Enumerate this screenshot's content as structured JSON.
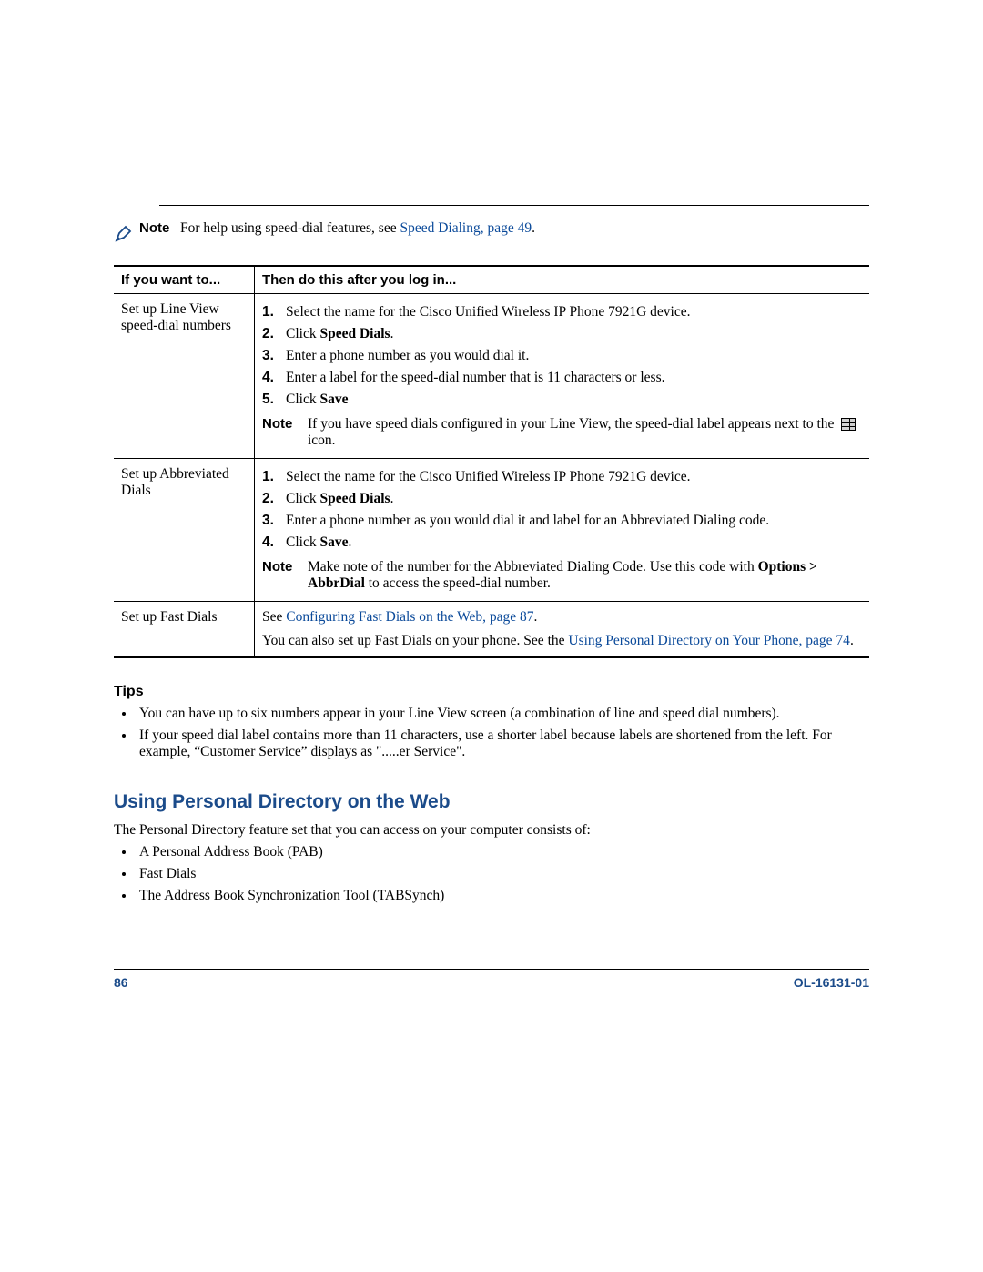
{
  "note": {
    "label": "Note",
    "text_prefix": "For help using speed-dial features, see ",
    "link": "Speed Dialing, page 49",
    "text_suffix": "."
  },
  "table": {
    "headers": {
      "col1": "If you want to...",
      "col2": "Then do this after you log in..."
    },
    "rows": [
      {
        "left": "Set up Line View speed-dial numbers",
        "steps": [
          "Select the name for the Cisco Unified Wireless IP Phone 7921G device.",
          "Click |Speed Dials|.",
          "Enter a phone number as you would dial it.",
          "Enter a label for the speed-dial number that is 11 characters or less.",
          "Click |Save|"
        ],
        "note": {
          "label": "Note",
          "text_pre": "If you have speed dials configured in your Line View, the speed-dial label appears next to the ",
          "text_post": " icon."
        }
      },
      {
        "left": "Set up Abbreviated Dials",
        "steps": [
          "Select the name for the Cisco Unified Wireless IP Phone 7921G device.",
          "Click |Speed Dials|.",
          "Enter a phone number as you would dial it and label for an Abbreviated Dialing code.",
          "Click |Save|."
        ],
        "note": {
          "label": "Note",
          "text": "Make note of the number for the Abbreviated Dialing Code. Use this code with |Options > AbbrDial| to access the speed-dial number."
        }
      },
      {
        "left": "Set up Fast Dials",
        "line1_pre": "See ",
        "line1_link": "Configuring Fast Dials on the Web, page 87",
        "line1_post": ".",
        "line2_pre": "You can also set up Fast Dials on your phone. See the ",
        "line2_link": "Using Personal Directory on Your Phone, page 74",
        "line2_post": "."
      }
    ]
  },
  "tips": {
    "heading": "Tips",
    "items": [
      "You can have up to six numbers appear in your Line View screen (a combination of line and speed dial numbers).",
      "If your speed dial label contains more than 11 characters, use a shorter label because labels are shortened from the left. For example, “Customer Service” displays as \".....er Service\"."
    ]
  },
  "section": {
    "heading": "Using Personal Directory on the Web",
    "intro": "The Personal Directory feature set that you can access on your computer consists of:",
    "items": [
      "A Personal Address Book (PAB)",
      "Fast Dials",
      "The Address Book Synchronization Tool (TABSynch)"
    ]
  },
  "footer": {
    "page": "86",
    "docnum": "OL-16131-01"
  }
}
